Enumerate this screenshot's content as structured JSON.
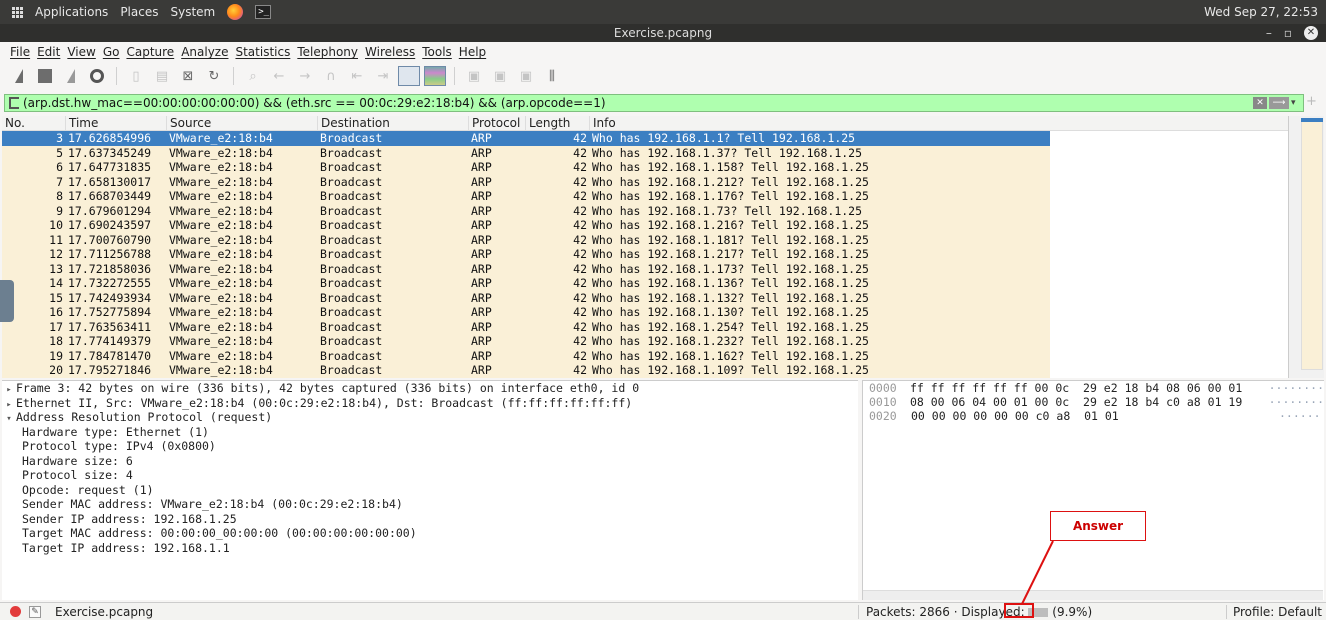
{
  "system_bar": {
    "applications": "Applications",
    "places": "Places",
    "system": "System",
    "clock": "Wed Sep 27, 22:53"
  },
  "window": {
    "title": "Exercise.pcapng"
  },
  "menu": [
    "File",
    "Edit",
    "View",
    "Go",
    "Capture",
    "Analyze",
    "Statistics",
    "Telephony",
    "Wireless",
    "Tools",
    "Help"
  ],
  "filter": {
    "value": "(arp.dst.hw_mac==00:00:00:00:00:00) && (eth.src == 00:0c:29:e2:18:b4) && (arp.opcode==1)",
    "accent_color": "#afffaf"
  },
  "packet_list": {
    "columns": [
      "No.",
      "Time",
      "Source",
      "Destination",
      "Protocol",
      "Length",
      "Info"
    ],
    "rows": [
      {
        "no": "3",
        "time": "17.626854996",
        "src": "VMware_e2:18:b4",
        "dst": "Broadcast",
        "proto": "ARP",
        "len": "42",
        "info": "Who has 192.168.1.1? Tell 192.168.1.25"
      },
      {
        "no": "5",
        "time": "17.637345249",
        "src": "VMware_e2:18:b4",
        "dst": "Broadcast",
        "proto": "ARP",
        "len": "42",
        "info": "Who has 192.168.1.37? Tell 192.168.1.25"
      },
      {
        "no": "6",
        "time": "17.647731835",
        "src": "VMware_e2:18:b4",
        "dst": "Broadcast",
        "proto": "ARP",
        "len": "42",
        "info": "Who has 192.168.1.158? Tell 192.168.1.25"
      },
      {
        "no": "7",
        "time": "17.658130017",
        "src": "VMware_e2:18:b4",
        "dst": "Broadcast",
        "proto": "ARP",
        "len": "42",
        "info": "Who has 192.168.1.212? Tell 192.168.1.25"
      },
      {
        "no": "8",
        "time": "17.668703449",
        "src": "VMware_e2:18:b4",
        "dst": "Broadcast",
        "proto": "ARP",
        "len": "42",
        "info": "Who has 192.168.1.176? Tell 192.168.1.25"
      },
      {
        "no": "9",
        "time": "17.679601294",
        "src": "VMware_e2:18:b4",
        "dst": "Broadcast",
        "proto": "ARP",
        "len": "42",
        "info": "Who has 192.168.1.73? Tell 192.168.1.25"
      },
      {
        "no": "10",
        "time": "17.690243597",
        "src": "VMware_e2:18:b4",
        "dst": "Broadcast",
        "proto": "ARP",
        "len": "42",
        "info": "Who has 192.168.1.216? Tell 192.168.1.25"
      },
      {
        "no": "11",
        "time": "17.700760790",
        "src": "VMware_e2:18:b4",
        "dst": "Broadcast",
        "proto": "ARP",
        "len": "42",
        "info": "Who has 192.168.1.181? Tell 192.168.1.25"
      },
      {
        "no": "12",
        "time": "17.711256788",
        "src": "VMware_e2:18:b4",
        "dst": "Broadcast",
        "proto": "ARP",
        "len": "42",
        "info": "Who has 192.168.1.217? Tell 192.168.1.25"
      },
      {
        "no": "13",
        "time": "17.721858036",
        "src": "VMware_e2:18:b4",
        "dst": "Broadcast",
        "proto": "ARP",
        "len": "42",
        "info": "Who has 192.168.1.173? Tell 192.168.1.25"
      },
      {
        "no": "14",
        "time": "17.732272555",
        "src": "VMware_e2:18:b4",
        "dst": "Broadcast",
        "proto": "ARP",
        "len": "42",
        "info": "Who has 192.168.1.136? Tell 192.168.1.25"
      },
      {
        "no": "15",
        "time": "17.742493934",
        "src": "VMware_e2:18:b4",
        "dst": "Broadcast",
        "proto": "ARP",
        "len": "42",
        "info": "Who has 192.168.1.132? Tell 192.168.1.25"
      },
      {
        "no": "16",
        "time": "17.752775894",
        "src": "VMware_e2:18:b4",
        "dst": "Broadcast",
        "proto": "ARP",
        "len": "42",
        "info": "Who has 192.168.1.130? Tell 192.168.1.25"
      },
      {
        "no": "17",
        "time": "17.763563411",
        "src": "VMware_e2:18:b4",
        "dst": "Broadcast",
        "proto": "ARP",
        "len": "42",
        "info": "Who has 192.168.1.254? Tell 192.168.1.25"
      },
      {
        "no": "18",
        "time": "17.774149379",
        "src": "VMware_e2:18:b4",
        "dst": "Broadcast",
        "proto": "ARP",
        "len": "42",
        "info": "Who has 192.168.1.232? Tell 192.168.1.25"
      },
      {
        "no": "19",
        "time": "17.784781470",
        "src": "VMware_e2:18:b4",
        "dst": "Broadcast",
        "proto": "ARP",
        "len": "42",
        "info": "Who has 192.168.1.162? Tell 192.168.1.25"
      },
      {
        "no": "20",
        "time": "17.795271846",
        "src": "VMware_e2:18:b4",
        "dst": "Broadcast",
        "proto": "ARP",
        "len": "42",
        "info": "Who has 192.168.1.109? Tell 192.168.1.25"
      }
    ]
  },
  "details": [
    {
      "twisty": "▸",
      "indent": false,
      "text": "Frame 3: 42 bytes on wire (336 bits), 42 bytes captured (336 bits) on interface eth0, id 0"
    },
    {
      "twisty": "▸",
      "indent": false,
      "text": "Ethernet II, Src: VMware_e2:18:b4 (00:0c:29:e2:18:b4), Dst: Broadcast (ff:ff:ff:ff:ff:ff)"
    },
    {
      "twisty": "▾",
      "indent": false,
      "text": "Address Resolution Protocol (request)"
    },
    {
      "twisty": "",
      "indent": true,
      "text": "Hardware type: Ethernet (1)"
    },
    {
      "twisty": "",
      "indent": true,
      "text": "Protocol type: IPv4 (0x0800)"
    },
    {
      "twisty": "",
      "indent": true,
      "text": "Hardware size: 6"
    },
    {
      "twisty": "",
      "indent": true,
      "text": "Protocol size: 4"
    },
    {
      "twisty": "",
      "indent": true,
      "text": "Opcode: request (1)"
    },
    {
      "twisty": "",
      "indent": true,
      "text": "Sender MAC address: VMware_e2:18:b4 (00:0c:29:e2:18:b4)"
    },
    {
      "twisty": "",
      "indent": true,
      "text": "Sender IP address: 192.168.1.25"
    },
    {
      "twisty": "",
      "indent": true,
      "text": "Target MAC address: 00:00:00_00:00:00 (00:00:00:00:00:00)"
    },
    {
      "twisty": "",
      "indent": true,
      "text": "Target IP address: 192.168.1.1"
    }
  ],
  "bytes": [
    {
      "offset": "0000",
      "hex": "ff ff ff ff ff ff 00 0c  29 e2 18 b4 08 06 00 01",
      "ascii": "········"
    },
    {
      "offset": "0010",
      "hex": "08 00 06 04 00 01 00 0c  29 e2 18 b4 c0 a8 01 19",
      "ascii": "········"
    },
    {
      "offset": "0020",
      "hex": "00 00 00 00 00 00 c0 a8  01 01",
      "ascii": "······"
    }
  ],
  "status": {
    "file": "Exercise.pcapng",
    "packets_prefix": "Packets: 2866 · Displayed:",
    "packets_suffix": "(9.9%)",
    "profile": "Profile: Default"
  },
  "annotation": {
    "label": "Answer",
    "color": "#dd1111"
  }
}
